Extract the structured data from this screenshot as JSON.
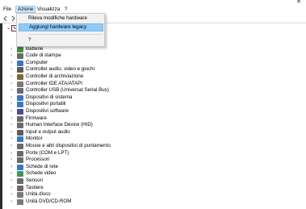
{
  "window": {
    "close_glyph": "✕"
  },
  "menubar": {
    "items": [
      {
        "label": "File"
      },
      {
        "label": "Azione",
        "active": true
      },
      {
        "label": "Visualizza"
      },
      {
        "label": "?"
      }
    ]
  },
  "toolbar": {
    "buttons": [
      {
        "icon": "back-arrow-icon"
      },
      {
        "icon": "forward-arrow-icon"
      }
    ]
  },
  "dropdown": {
    "items": [
      {
        "label": "Rileva modifiche hardware",
        "highlight": false
      },
      {
        "label": "Aggiungi hardware legacy",
        "highlight": true
      },
      {
        "label": "?",
        "highlight": false
      }
    ]
  },
  "tree": {
    "root": {
      "expander": "⌄"
    },
    "items": [
      {
        "label": "Batterie",
        "icon": "battery-icon",
        "color": "#4a8f3a"
      },
      {
        "label": "Code di stampa",
        "icon": "printer-icon",
        "color": "#6b6b6b"
      },
      {
        "label": "Computer",
        "icon": "computer-icon",
        "color": "#3a78c4"
      },
      {
        "label": "Controller audio, video e giochi",
        "icon": "speaker-icon",
        "color": "#5a5a5a"
      },
      {
        "label": "Controller di archiviazione",
        "icon": "storage-controller-icon",
        "color": "#7a6a3a"
      },
      {
        "label": "Controller IDE ATA/ATAPI",
        "icon": "ide-controller-icon",
        "color": "#7a7a7a"
      },
      {
        "label": "Controller USB (Universal Serial Bus)",
        "icon": "usb-icon",
        "color": "#6a6a6a"
      },
      {
        "label": "Dispositivi di sistema",
        "icon": "system-device-icon",
        "color": "#3a78c4"
      },
      {
        "label": "Dispositivi portatili",
        "icon": "portable-device-icon",
        "color": "#3a78c4"
      },
      {
        "label": "Dispositivi software",
        "icon": "software-device-icon",
        "color": "#4a4a9a"
      },
      {
        "label": "Firmware",
        "icon": "firmware-icon",
        "color": "#6b6b6b"
      },
      {
        "label": "Human Interface Device (HID)",
        "icon": "hid-icon",
        "color": "#6b6b6b"
      },
      {
        "label": "Input e output audio",
        "icon": "audio-io-icon",
        "color": "#5a5a5a"
      },
      {
        "label": "Monitor",
        "icon": "monitor-icon",
        "color": "#3a78c4"
      },
      {
        "label": "Mouse e altri dispositivi di puntamento",
        "icon": "mouse-icon",
        "color": "#6b6b6b"
      },
      {
        "label": "Porte (COM e LPT)",
        "icon": "port-icon",
        "color": "#6b6b6b"
      },
      {
        "label": "Processori",
        "icon": "processor-icon",
        "color": "#6b6b6b"
      },
      {
        "label": "Schede di rete",
        "icon": "network-adapter-icon",
        "color": "#3a78c4"
      },
      {
        "label": "Schede video",
        "icon": "display-adapter-icon",
        "color": "#3a9a5a"
      },
      {
        "label": "Sensori",
        "icon": "sensor-icon",
        "color": "#6b6b6b"
      },
      {
        "label": "Tastiere",
        "icon": "keyboard-icon",
        "color": "#6b6b6b"
      },
      {
        "label": "Unità disco",
        "icon": "disk-drive-icon",
        "color": "#7a7a7a"
      },
      {
        "label": "Unità DVD/CD-ROM",
        "icon": "dvd-drive-icon",
        "color": "#7a7a7a"
      }
    ],
    "expander": "›"
  }
}
